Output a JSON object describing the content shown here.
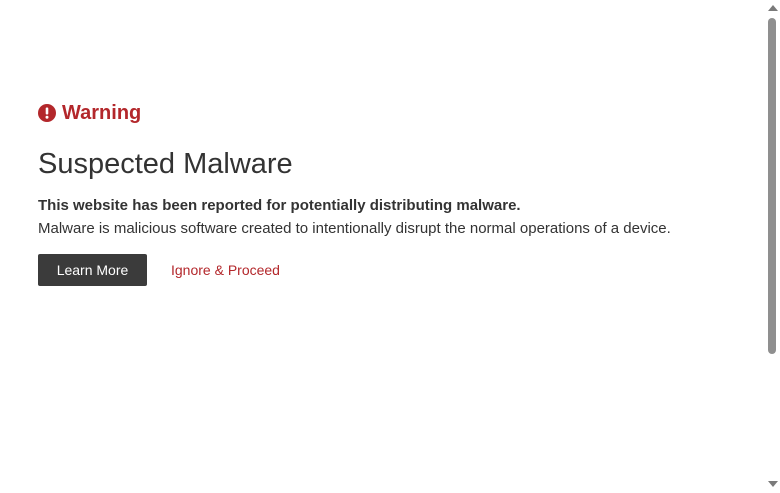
{
  "warning": {
    "label": "Warning",
    "icon": "exclamation-circle-icon",
    "color": "#b3272b"
  },
  "title": "Suspected Malware",
  "lead": "This website has been reported for potentially distributing malware.",
  "description": "Malware is malicious software created to intentionally disrupt the normal operations of a device.",
  "actions": {
    "learn_more": "Learn More",
    "ignore": "Ignore & Proceed"
  },
  "colors": {
    "accent": "#b3272b",
    "button_bg": "#3b3b3b",
    "text": "#333333"
  }
}
